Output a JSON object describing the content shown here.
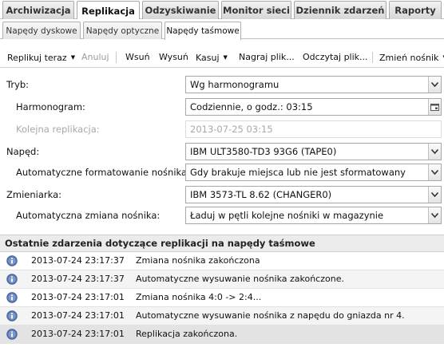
{
  "main_tabs": [
    {
      "label": "Archiwizacja",
      "active": false
    },
    {
      "label": "Replikacja",
      "active": true
    },
    {
      "label": "Odzyskiwanie",
      "active": false
    },
    {
      "label": "Monitor sieci",
      "active": false
    },
    {
      "label": "Dziennik zdarzeń",
      "active": false
    },
    {
      "label": "Raporty",
      "active": false
    }
  ],
  "sub_tabs": [
    {
      "label": "Napędy dyskowe",
      "active": false
    },
    {
      "label": "Napędy optyczne",
      "active": false
    },
    {
      "label": "Napędy taśmowe",
      "active": true
    }
  ],
  "toolbar": {
    "replicate_now": "Replikuj teraz",
    "cancel": "Anuluj",
    "insert": "Wsuń",
    "eject": "Wysuń",
    "delete": "Kasuj",
    "burn_file": "Nagraj plik...",
    "read_file": "Odczytaj plik...",
    "change_media": "Zmień nośnik"
  },
  "form": {
    "mode": {
      "label": "Tryb:",
      "value": "Wg harmonogramu"
    },
    "schedule": {
      "label": "Harmonogram:",
      "value": "Codziennie, o godz.: 03:15"
    },
    "next_replication": {
      "label": "Kolejna replikacja:",
      "value": "2013-07-25 03:15"
    },
    "drive": {
      "label": "Napęd:",
      "value": "IBM ULT3580-TD3 93G6 (TAPE0)"
    },
    "auto_format": {
      "label": "Automatyczne formatowanie nośnika:",
      "value": "Gdy brakuje miejsca lub nie jest sformatowany"
    },
    "changer": {
      "label": "Zmieniarka:",
      "value": "IBM 3573-TL 8.62 (CHANGER0)"
    },
    "auto_change": {
      "label": "Automatyczna zmiana nośnika:",
      "value": "Ładuj w pętli kolejne nośniki w magazynie"
    }
  },
  "events": {
    "title": "Ostatnie zdarzenia dotyczące replikacji na napędy taśmowe",
    "rows": [
      {
        "time": "2013-07-24 23:17:37",
        "message": "Zmiana nośnika zakończona"
      },
      {
        "time": "2013-07-24 23:17:37",
        "message": "Automatyczne wysuwanie nośnika zakończone."
      },
      {
        "time": "2013-07-24 23:17:01",
        "message": "Zmiana nośnika 4:0 -> 2:4..."
      },
      {
        "time": "2013-07-24 23:17:01",
        "message": "Automatyczne wysuwanie nośnika z napędu do gniazda nr 4."
      },
      {
        "time": "2013-07-24 23:17:01",
        "message": "Replikacja zakończona."
      }
    ]
  },
  "icons": {
    "dropdown": "chevron-down-icon",
    "calendar": "calendar-icon",
    "event": "info-icon"
  },
  "colors": {
    "info_icon": "#5a78b0",
    "header_bg": "#ebebeb",
    "selected_row": "#e3e3e3"
  }
}
